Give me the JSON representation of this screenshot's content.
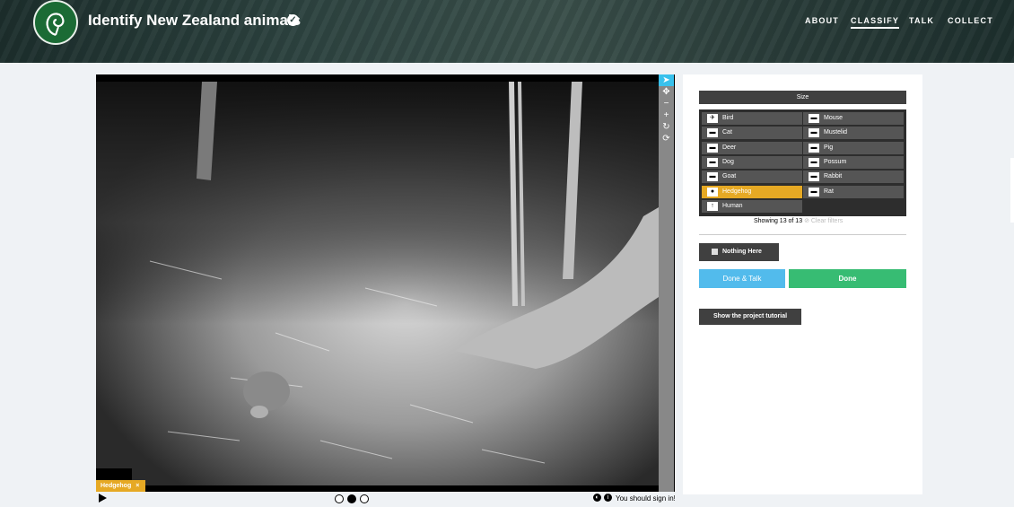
{
  "header": {
    "title": "Identify New Zealand animals",
    "nav": [
      "ABOUT",
      "CLASSIFY",
      "TALK",
      "COLLECT"
    ],
    "active_nav": "CLASSIFY",
    "logo_icon": "fern-spiral-icon",
    "verified_icon": "check-circle-icon"
  },
  "viewer": {
    "tag_label": "Hedgehog",
    "tools": [
      "pointer-icon",
      "move-icon",
      "zoom-out-icon",
      "zoom-in-icon",
      "rotate-icon",
      "reset-icon"
    ],
    "frames": 3,
    "current_frame": 2,
    "sign_in_text": "You should sign in!"
  },
  "task": {
    "filter_label": "Size",
    "choices": [
      {
        "label": "Bird",
        "icon": "bird-icon"
      },
      {
        "label": "Mouse",
        "icon": "mouse-icon"
      },
      {
        "label": "Cat",
        "icon": "cat-icon"
      },
      {
        "label": "Mustelid",
        "icon": "mustelid-icon"
      },
      {
        "label": "Deer",
        "icon": "deer-icon"
      },
      {
        "label": "Pig",
        "icon": "pig-icon"
      },
      {
        "label": "Dog",
        "icon": "dog-icon"
      },
      {
        "label": "Possum",
        "icon": "possum-icon"
      },
      {
        "label": "Goat",
        "icon": "goat-icon"
      },
      {
        "label": "Rabbit",
        "icon": "rabbit-icon"
      },
      {
        "label": "Hedgehog",
        "icon": "hedgehog-icon"
      },
      {
        "label": "Rat",
        "icon": "rat-icon"
      },
      {
        "label": "Human",
        "icon": "human-icon"
      }
    ],
    "selected": "Hedgehog",
    "showing_text": "Showing 13 of 13",
    "clear_filters": "Clear filters",
    "nothing_here": "Nothing Here",
    "done_talk": "Done & Talk",
    "done": "Done",
    "tutorial": "Show the project tutorial"
  },
  "colors": {
    "accent_yellow": "#e6a924",
    "done_green": "#37bc73",
    "done_talk_blue": "#52bbec",
    "dark_button": "#404040"
  }
}
